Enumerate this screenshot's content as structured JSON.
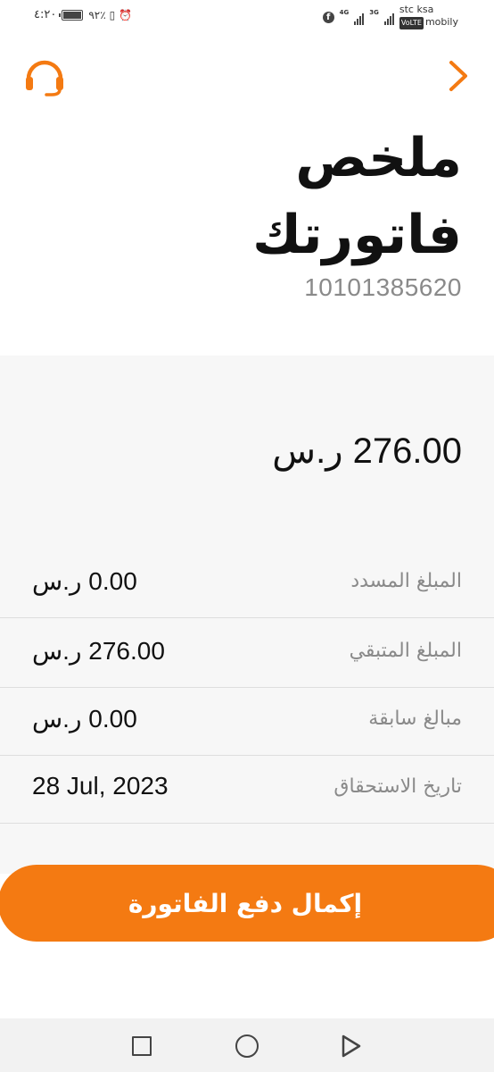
{
  "status_bar": {
    "time": "٤:٢٠",
    "battery": "٪٩٢",
    "carrier_1": "stc ksa",
    "carrier_2": "mobily",
    "volte": "VoLTE",
    "net_1": "4G",
    "net_2": "3G"
  },
  "header": {
    "title_line_1": "ملخص",
    "title_line_2": "فاتورتك",
    "account_number": "10101385620"
  },
  "summary": {
    "total_amount": "276.00 ر.س",
    "rows": [
      {
        "label": "المبلغ المسدد",
        "value": "0.00 ر.س"
      },
      {
        "label": "المبلغ المتبقي",
        "value": "276.00 ر.س"
      },
      {
        "label": "مبالغ سابقة",
        "value": "0.00 ر.س"
      },
      {
        "label": "تاريخ الاستحقاق",
        "value": "28 Jul, 2023"
      }
    ]
  },
  "pay_button": {
    "label": "إكمال دفع الفاتورة"
  },
  "colors": {
    "accent": "#f47a12",
    "muted_text": "#8a8a8a",
    "panel_bg": "#f7f7f7"
  },
  "icons": {
    "support": "headset-icon",
    "back": "chevron-right-icon",
    "nav_recent": "square-icon",
    "nav_home": "circle-icon",
    "nav_back": "triangle-back-icon"
  }
}
